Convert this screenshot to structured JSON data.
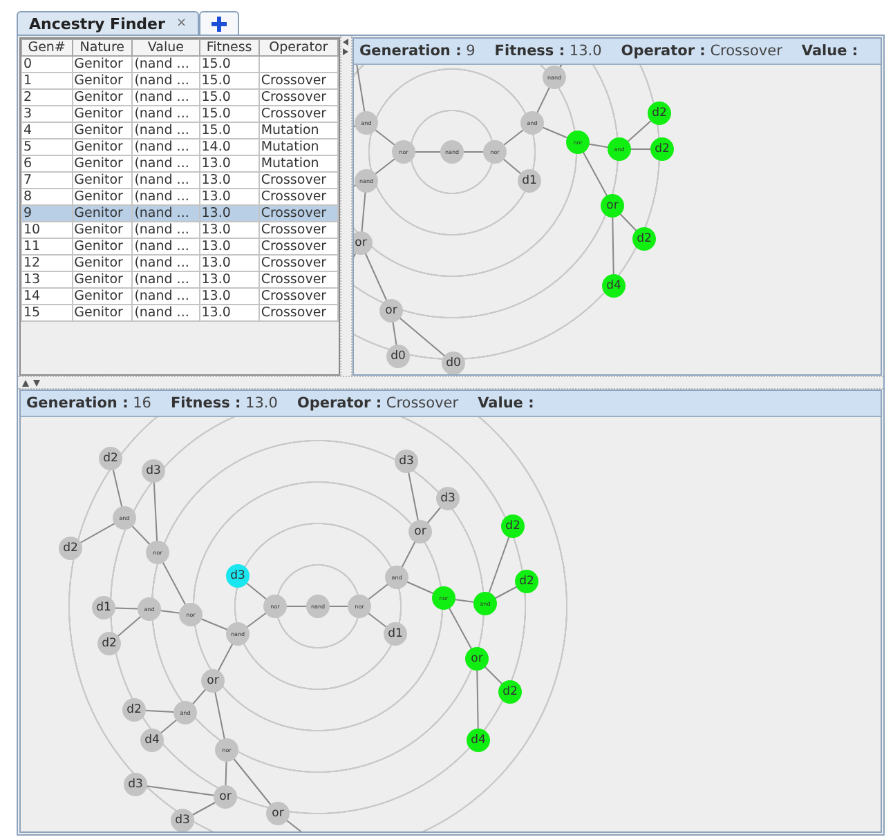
{
  "tabs": [
    {
      "label": "Ancestry Finder",
      "close": "×",
      "selected": true,
      "kind": "text"
    },
    {
      "selected": false,
      "kind": "add"
    }
  ],
  "table": {
    "columns": [
      "Gen#",
      "Nature",
      "Value",
      "Fitness",
      "Operator"
    ],
    "rows": [
      {
        "cells": [
          "0",
          "Genitor",
          "(nand ...",
          "15.0",
          ""
        ],
        "selected": false
      },
      {
        "cells": [
          "1",
          "Genitor",
          "(nand ...",
          "15.0",
          "Crossover"
        ],
        "selected": false
      },
      {
        "cells": [
          "2",
          "Genitor",
          "(nand ...",
          "15.0",
          "Crossover"
        ],
        "selected": false
      },
      {
        "cells": [
          "3",
          "Genitor",
          "(nand ...",
          "15.0",
          "Crossover"
        ],
        "selected": false
      },
      {
        "cells": [
          "4",
          "Genitor",
          "(nand ...",
          "15.0",
          "Mutation"
        ],
        "selected": false
      },
      {
        "cells": [
          "5",
          "Genitor",
          "(nand ...",
          "14.0",
          "Mutation"
        ],
        "selected": false
      },
      {
        "cells": [
          "6",
          "Genitor",
          "(nand ...",
          "13.0",
          "Mutation"
        ],
        "selected": false
      },
      {
        "cells": [
          "7",
          "Genitor",
          "(nand ...",
          "13.0",
          "Crossover"
        ],
        "selected": false
      },
      {
        "cells": [
          "8",
          "Genitor",
          "(nand ...",
          "13.0",
          "Crossover"
        ],
        "selected": false
      },
      {
        "cells": [
          "9",
          "Genitor",
          "(nand ...",
          "13.0",
          "Crossover"
        ],
        "selected": true
      },
      {
        "cells": [
          "10",
          "Genitor",
          "(nand ...",
          "13.0",
          "Crossover"
        ],
        "selected": false
      },
      {
        "cells": [
          "11",
          "Genitor",
          "(nand ...",
          "13.0",
          "Crossover"
        ],
        "selected": false
      },
      {
        "cells": [
          "12",
          "Genitor",
          "(nand ...",
          "13.0",
          "Crossover"
        ],
        "selected": false
      },
      {
        "cells": [
          "13",
          "Genitor",
          "(nand ...",
          "13.0",
          "Crossover"
        ],
        "selected": false
      },
      {
        "cells": [
          "14",
          "Genitor",
          "(nand ...",
          "13.0",
          "Crossover"
        ],
        "selected": false
      },
      {
        "cells": [
          "15",
          "Genitor",
          "(nand ...",
          "13.0",
          "Crossover"
        ],
        "selected": false
      }
    ]
  },
  "graphs": [
    {
      "header": [
        {
          "label": "Generation :",
          "value": "9"
        },
        {
          "label": "Fitness :",
          "value": "13.0"
        },
        {
          "label": "Operator :",
          "value": "Crossover"
        },
        {
          "label": "Value :"
        }
      ],
      "tree": {
        "label": "nand",
        "color": "#c3c3c3",
        "children": [
          {
            "label": "nor",
            "color": "#c3c3c3",
            "children": [
              {
                "label": "and",
                "color": "#c3c3c3"
              },
              {
                "label": "nand",
                "color": "#c3c3c3",
                "children": [
                  {
                    "label": "or",
                    "color": "#c3c3c3",
                    "children": [
                      {
                        "label": "or",
                        "color": "#c3c3c3",
                        "children": [
                          {
                            "label": "d0",
                            "color": "#c3c3c3"
                          },
                          {
                            "label": "d0",
                            "color": "#c3c3c3"
                          }
                        ]
                      }
                    ]
                  }
                ]
              }
            ]
          },
          {
            "label": "nor",
            "color": "#c3c3c3",
            "children": [
              {
                "label": "and",
                "color": "#c3c3c3",
                "children": [
                  {
                    "label": "nand",
                    "color": "#c3c3c3"
                  },
                  {
                    "label": "nor",
                    "color": "#11ee11",
                    "children": [
                      {
                        "label": "and",
                        "color": "#11ee11",
                        "children": [
                          {
                            "label": "d2",
                            "color": "#11ee11"
                          },
                          {
                            "label": "d2",
                            "color": "#11ee11"
                          }
                        ]
                      },
                      {
                        "label": "or",
                        "color": "#11ee11",
                        "children": [
                          {
                            "label": "d2",
                            "color": "#11ee11"
                          },
                          {
                            "label": "d4",
                            "color": "#11ee11"
                          }
                        ]
                      }
                    ]
                  }
                ]
              },
              {
                "label": "d1",
                "color": "#c3c3c3"
              }
            ]
          }
        ]
      }
    },
    {
      "header": [
        {
          "label": "Generation :",
          "value": "16"
        },
        {
          "label": "Fitness :",
          "value": "13.0"
        },
        {
          "label": "Operator :",
          "value": "Crossover"
        },
        {
          "label": "Value :"
        }
      ],
      "tree": {
        "label": "nand",
        "color": "#c3c3c3",
        "children": [
          {
            "label": "nor",
            "color": "#c3c3c3",
            "children": [
              {
                "label": "d3",
                "color": "#19e6ee"
              },
              {
                "label": "nand",
                "color": "#c3c3c3",
                "children": [
                  {
                    "label": "nor",
                    "color": "#c3c3c3",
                    "children": [
                      {
                        "label": "nor",
                        "color": "#c3c3c3",
                        "children": [
                          {
                            "label": "and",
                            "color": "#c3c3c3",
                            "children": [
                              {
                                "label": "d2",
                                "color": "#c3c3c3"
                              },
                              {
                                "label": "d2",
                                "color": "#c3c3c3"
                              }
                            ]
                          },
                          {
                            "label": "d3",
                            "color": "#c3c3c3"
                          }
                        ]
                      },
                      {
                        "label": "and",
                        "color": "#c3c3c3",
                        "children": [
                          {
                            "label": "d1",
                            "color": "#c3c3c3"
                          },
                          {
                            "label": "d2",
                            "color": "#c3c3c3"
                          }
                        ]
                      }
                    ]
                  },
                  {
                    "label": "or",
                    "color": "#c3c3c3",
                    "children": [
                      {
                        "label": "and",
                        "color": "#c3c3c3",
                        "children": [
                          {
                            "label": "d2",
                            "color": "#c3c3c3"
                          },
                          {
                            "label": "d4",
                            "color": "#c3c3c3"
                          }
                        ]
                      },
                      {
                        "label": "nor",
                        "color": "#c3c3c3",
                        "children": [
                          {
                            "label": "or",
                            "color": "#c3c3c3",
                            "children": [
                              {
                                "label": "d3",
                                "color": "#c3c3c3"
                              },
                              {
                                "label": "d3",
                                "color": "#c3c3c3"
                              }
                            ]
                          },
                          {
                            "label": "or",
                            "color": "#c3c3c3"
                          }
                        ]
                      }
                    ]
                  }
                ]
              }
            ]
          },
          {
            "label": "nor",
            "color": "#c3c3c3",
            "children": [
              {
                "label": "and",
                "color": "#c3c3c3",
                "children": [
                  {
                    "label": "or",
                    "color": "#c3c3c3",
                    "children": [
                      {
                        "label": "d3",
                        "color": "#c3c3c3"
                      },
                      {
                        "label": "d3",
                        "color": "#c3c3c3"
                      }
                    ]
                  },
                  {
                    "label": "nor",
                    "color": "#11ee11",
                    "children": [
                      {
                        "label": "and",
                        "color": "#11ee11",
                        "children": [
                          {
                            "label": "d2",
                            "color": "#11ee11"
                          },
                          {
                            "label": "d2",
                            "color": "#11ee11"
                          }
                        ]
                      },
                      {
                        "label": "or",
                        "color": "#11ee11",
                        "children": [
                          {
                            "label": "d2",
                            "color": "#11ee11"
                          },
                          {
                            "label": "d4",
                            "color": "#11ee11"
                          }
                        ]
                      }
                    ]
                  }
                ]
              },
              {
                "label": "d1",
                "color": "#c3c3c3"
              }
            ]
          }
        ]
      }
    }
  ]
}
